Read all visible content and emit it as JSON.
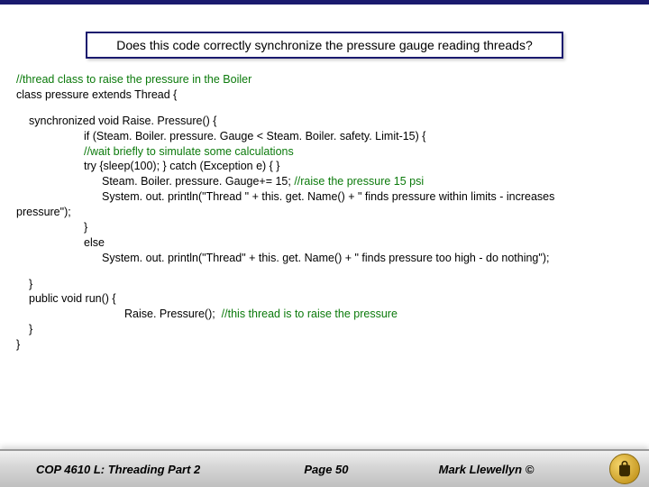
{
  "title": "Does this code correctly synchronize the pressure gauge reading threads?",
  "code": {
    "c1": "//thread class to raise the pressure in the Boiler",
    "l1": "class pressure extends Thread {",
    "l2": "synchronized void Raise. Pressure() {",
    "l3": "if (Steam. Boiler. pressure. Gauge < Steam. Boiler. safety. Limit-15) {",
    "c2": "//wait briefly to simulate some calculations",
    "l4": "try {sleep(100); } catch (Exception e) { }",
    "l5a": "Steam. Boiler. pressure. Gauge+= 15; ",
    "c3": "//raise the pressure 15 psi",
    "l6": "System. out. println(\"Thread \" + this. get. Name() + \" finds pressure within limits - increases",
    "l7": "pressure\");",
    "l8": "}",
    "l9": "else",
    "l10": "System. out. println(\"Thread\" + this. get. Name() + \" finds pressure too high - do nothing\");",
    "l11": "}",
    "l12": "public void run() {",
    "l13a": "Raise. Pressure();  ",
    "c4": "//this thread is to raise the pressure",
    "l14": "}",
    "l15": "}"
  },
  "footer": {
    "left": "COP 4610 L: Threading Part 2",
    "mid": "Page 50",
    "right": "Mark Llewellyn ©"
  }
}
